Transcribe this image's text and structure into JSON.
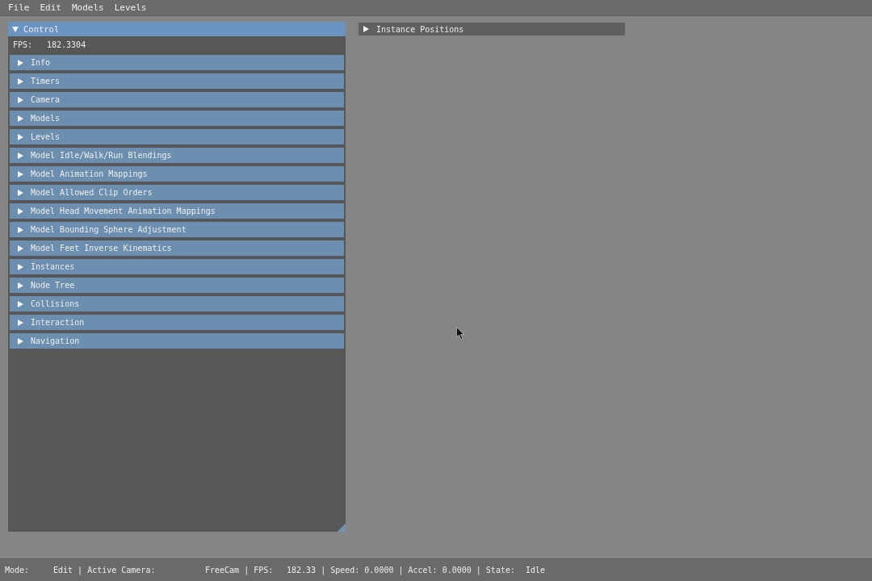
{
  "menu_bar": [
    "File",
    "Edit",
    "Models",
    "Levels"
  ],
  "control_window": {
    "title": "Control",
    "expanded": true,
    "fps_label": "FPS:",
    "fps_value": "182.3304",
    "sections": [
      {
        "label": "Info",
        "expanded": false
      },
      {
        "label": "Timers",
        "expanded": false
      },
      {
        "label": "Camera",
        "expanded": false
      },
      {
        "label": "Models",
        "expanded": false
      },
      {
        "label": "Levels",
        "expanded": false
      },
      {
        "label": "Model Idle/Walk/Run Blendings",
        "expanded": false
      },
      {
        "label": "Model Animation Mappings",
        "expanded": false
      },
      {
        "label": "Model Allowed Clip Orders",
        "expanded": false
      },
      {
        "label": "Model Head Movement Animation Mappings",
        "expanded": false
      },
      {
        "label": "Model Bounding Sphere Adjustment",
        "expanded": false
      },
      {
        "label": "Model Feet Inverse Kinematics",
        "expanded": false
      },
      {
        "label": "Instances",
        "expanded": false
      },
      {
        "label": "Node Tree",
        "expanded": false
      },
      {
        "label": "Collisions",
        "expanded": false
      },
      {
        "label": "Interaction",
        "expanded": false
      },
      {
        "label": "Navigation",
        "expanded": false
      }
    ]
  },
  "instance_window": {
    "title": "Instance Positions",
    "expanded": false
  },
  "status_bar": [
    "Mode:",
    "Edit | Active Camera:",
    "FreeCam | FPS:",
    "182.33 | Speed: 0.0000 | Accel: 0.0000 | State:",
    "Idle"
  ]
}
